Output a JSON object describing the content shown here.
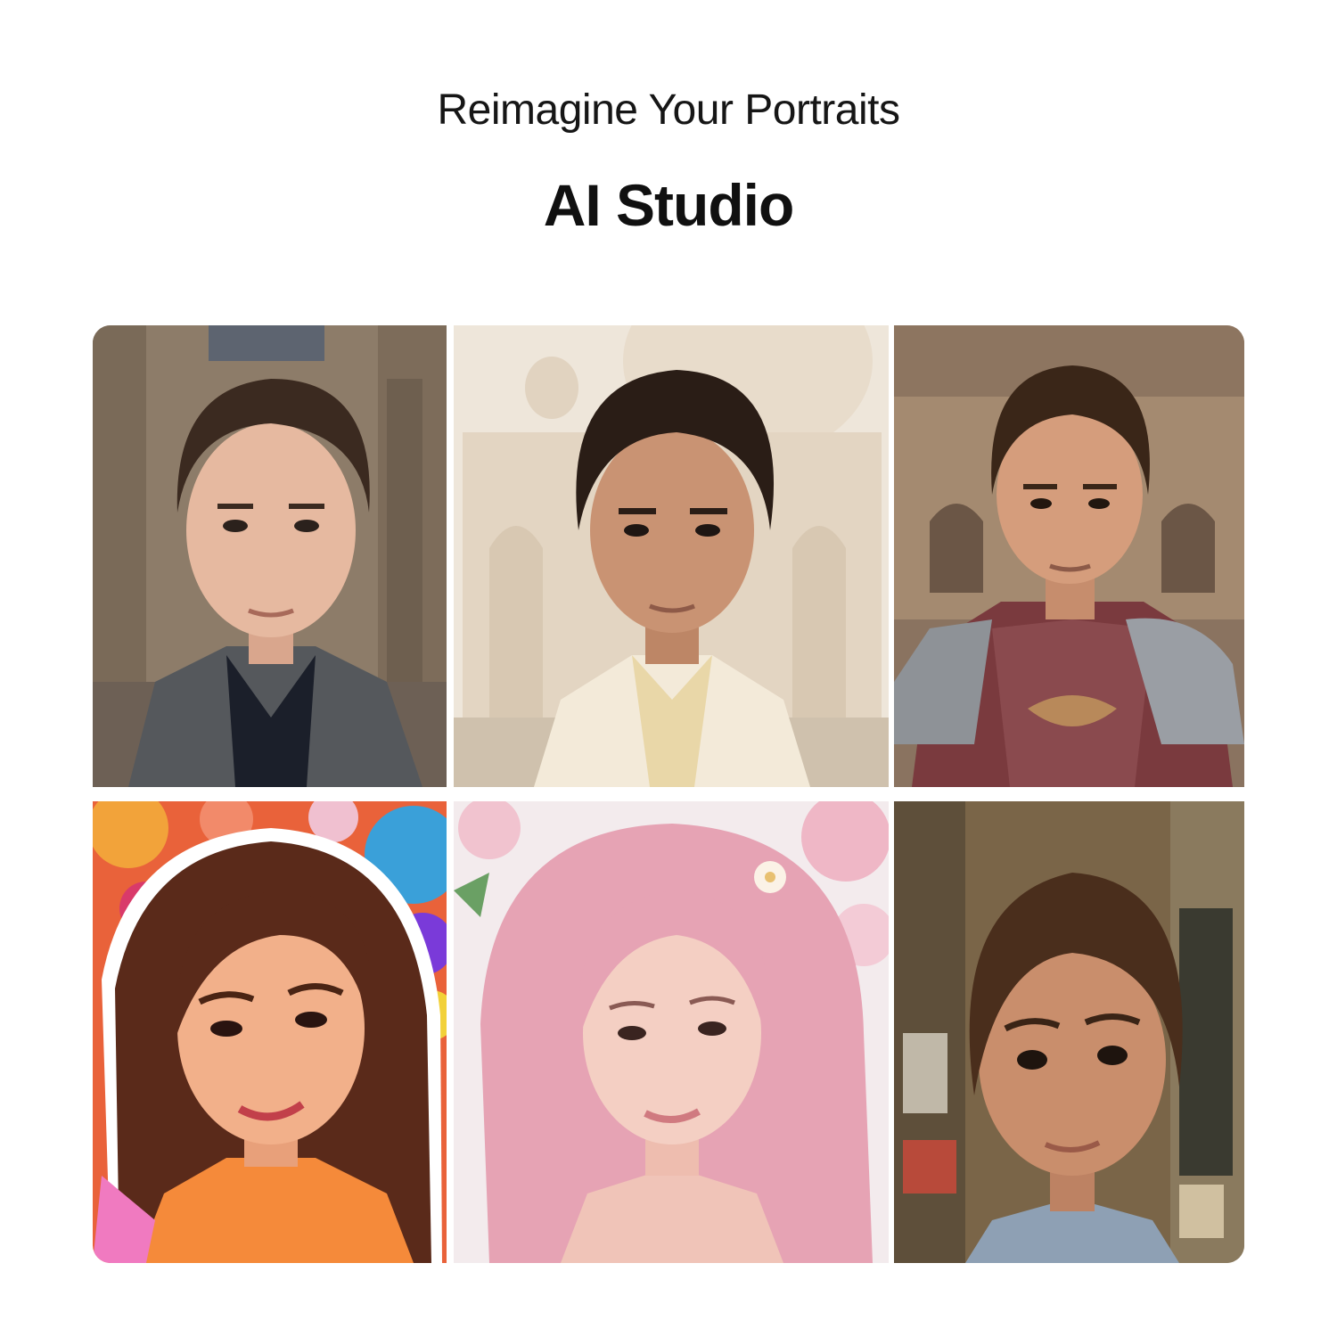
{
  "header": {
    "subtitle": "Reimagine Your Portraits",
    "title": "AI Studio"
  },
  "gallery": {
    "tiles": [
      {
        "name": "portrait-casual-coat",
        "scene": "brick-building",
        "colors": {
          "bg": "#8a7a68",
          "skin": "#e6b9a0",
          "hair": "#3b2a20",
          "clothing": "#55585c"
        }
      },
      {
        "name": "portrait-taj-mahal",
        "scene": "taj-mahal",
        "colors": {
          "bg": "#e9ddcd",
          "skin": "#c99373",
          "hair": "#2a1d16",
          "clothing": "#f3ead9"
        }
      },
      {
        "name": "portrait-armor-warrior",
        "scene": "colosseum",
        "colors": {
          "bg": "#9b7f66",
          "skin": "#d59d7c",
          "hair": "#3a2618",
          "clothing": "#7a3a3e"
        }
      },
      {
        "name": "portrait-sticker-art",
        "scene": "colorful-sticker",
        "colors": {
          "bg": "#e9623a",
          "skin": "#f2b08a",
          "hair": "#5a2a1a",
          "clothing": "#f58a3a"
        }
      },
      {
        "name": "portrait-pink-hair",
        "scene": "cherry-blossom",
        "colors": {
          "bg": "#f2e7ea",
          "skin": "#f4cfc3",
          "hair": "#e6a3b4",
          "clothing": "#f0c4b8"
        }
      },
      {
        "name": "portrait-3d-cartoon",
        "scene": "old-street",
        "colors": {
          "bg": "#7a6548",
          "skin": "#c98e6c",
          "hair": "#4a2e1c",
          "clothing": "#8ea0b4"
        }
      }
    ]
  }
}
